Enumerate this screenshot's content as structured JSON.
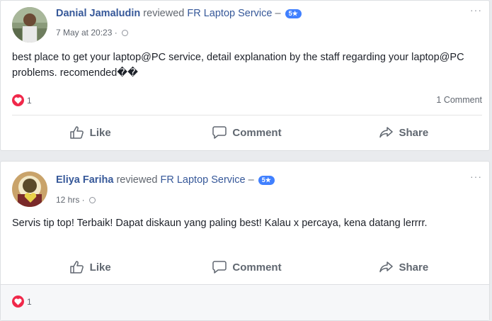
{
  "posts": [
    {
      "author": "Danial Jamaludin",
      "verb": "reviewed",
      "page": "FR Laptop Service",
      "dash": "–",
      "rating": "5★",
      "time": "7 May at 20:23 ·",
      "text": "best place to get your laptop@PC service, detail explanation by the staff regarding your laptop@PC problems. recomended��",
      "reaction_count": "1",
      "comment_count": "1 Comment",
      "actions": {
        "like": "Like",
        "comment": "Comment",
        "share": "Share"
      }
    },
    {
      "author": "Eliya Fariha",
      "verb": "reviewed",
      "page": "FR Laptop Service",
      "dash": "–",
      "rating": "5★",
      "time": "12 hrs ·",
      "text": "Servis tip top! Terbaik! Dapat diskaun yang paling best! Kalau x percaya, kena datang lerrrr.",
      "reaction_count": "1",
      "actions": {
        "like": "Like",
        "comment": "Comment",
        "share": "Share"
      }
    }
  ],
  "more_glyph": "···",
  "icons": [
    "like-icon",
    "comment-icon",
    "share-icon",
    "globe-icon",
    "heart-icon",
    "more-icon"
  ]
}
